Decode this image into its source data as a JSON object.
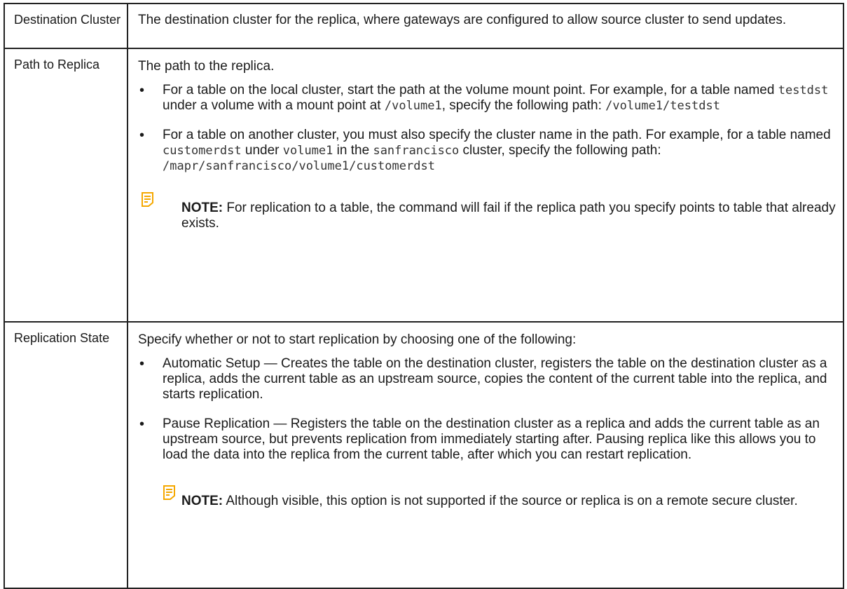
{
  "rows": [
    {
      "term": "Destination Cluster",
      "description": "The destination cluster for the replica, where gateways are configured to allow source cluster to send updates."
    },
    {
      "term": "Path to Replica",
      "intro": "The path to the replica.",
      "bullet1": {
        "t1": "For a table on the local cluster, start the path at the volume mount point. For example, for a table named ",
        "c1": "testdst",
        "t2": " under a volume with a mount point at ",
        "c2": "/volume1",
        "t3": ", specify the following path: ",
        "c3": "/volume1/testdst"
      },
      "bullet2": {
        "t1": "For a table on another cluster, you must also specify the cluster name in the path. For example, for a table named ",
        "c1": "customerdst",
        "t2": " under ",
        "c2": "volume1",
        "t3": " in the ",
        "c3": "sanfrancisco",
        "t4": " cluster, specify the following path: ",
        "c4": "/mapr/sanfrancisco/volume1/customerdst"
      },
      "note": {
        "label": "NOTE:",
        "text": " For replication to a table, the command will fail if the replica path you specify points to table that already exists."
      }
    },
    {
      "term": "Replication State",
      "intro": "Specify whether or not to start replication by choosing one of the following:",
      "bullet1": "Automatic Setup — Creates the table on the destination cluster, registers the table on the destination cluster as a replica, adds the current table as an upstream source, copies the content of the current table into the replica, and starts replication.",
      "bullet2": "Pause Replication — Registers the table on the destination cluster as a replica and adds the current table as an upstream source, but prevents replication from immediately starting after. Pausing replica like this allows you to load the data into the replica from the current table, after which you can restart replication.",
      "note": {
        "label": "NOTE:",
        "text": " Although visible, this option is not supported if the source or replica is on a remote secure cluster."
      }
    }
  ],
  "colors": {
    "note_icon": "#f5a800",
    "border": "#222222"
  },
  "icons": {
    "note": "note-icon"
  }
}
